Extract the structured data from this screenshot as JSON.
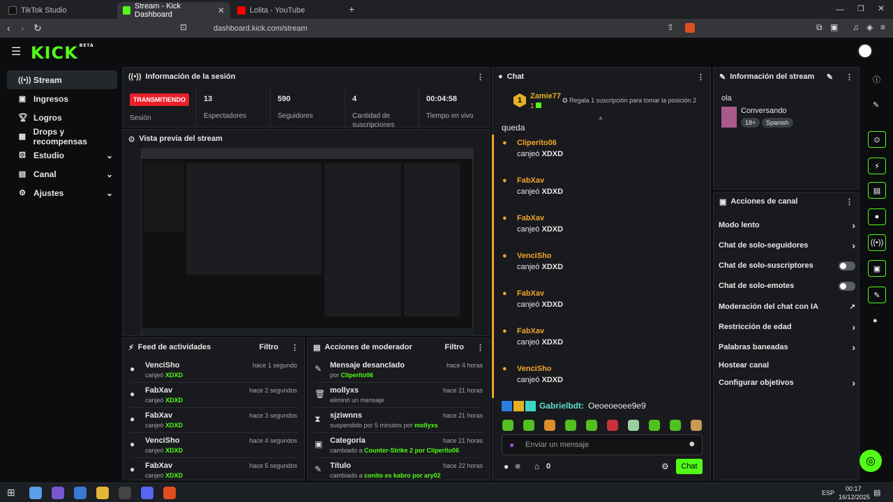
{
  "browser": {
    "tabs": [
      {
        "label": "TikTok Studio"
      },
      {
        "label": "Stream - Kick Dashboard"
      },
      {
        "label": "Lolita - YouTube"
      }
    ],
    "url": "dashboard.kick.com/stream",
    "new_tab": "+"
  },
  "kick": {
    "logo": "KICK",
    "logo_badge": "BETA"
  },
  "sidebar": {
    "items": [
      {
        "label": "Stream",
        "icon": "radio-icon"
      },
      {
        "label": "Ingresos",
        "icon": "wallet-icon"
      },
      {
        "label": "Logros",
        "icon": "trophy-icon"
      },
      {
        "label": "Drops y recompensas",
        "icon": "gift-icon"
      },
      {
        "label": "Estudio",
        "icon": "studio-icon"
      },
      {
        "label": "Canal",
        "icon": "channel-icon"
      },
      {
        "label": "Ajustes",
        "icon": "gear-icon"
      }
    ]
  },
  "session": {
    "title": "Información de la sesión",
    "live_badge": "TRANSMITIENDO",
    "stats": [
      {
        "value": "",
        "label": "Sesión"
      },
      {
        "value": "13",
        "label": "Espectadores"
      },
      {
        "value": "590",
        "label": "Seguidores"
      },
      {
        "value": "4",
        "label": "Cantidad de suscripciones"
      },
      {
        "value": "00:04:58",
        "label": "Tiempo en vivo"
      }
    ]
  },
  "preview": {
    "title": "Vista previa del stream"
  },
  "activity": {
    "title": "Feed de actividades",
    "filter": "Filtro",
    "items": [
      {
        "user": "VenciSho",
        "action": "canjeó",
        "item": "XDXD",
        "time": "hace 1 segundo"
      },
      {
        "user": "FabXav",
        "action": "canjeó",
        "item": "XDXD",
        "time": "hace 2 segundos"
      },
      {
        "user": "FabXav",
        "action": "canjeó",
        "item": "XDXD",
        "time": "hace 3 segundos"
      },
      {
        "user": "VenciSho",
        "action": "canjeó",
        "item": "XDXD",
        "time": "hace 4 segundos"
      },
      {
        "user": "FabXav",
        "action": "canjeó",
        "item": "XDXD",
        "time": "hace 5 segundos"
      }
    ]
  },
  "modactions": {
    "title": "Acciones de moderador",
    "filter": "Filtro",
    "items": [
      {
        "title": "Mensaje desanclado",
        "sub": "por",
        "who": "Cliperito06",
        "time": "hace 4 horas"
      },
      {
        "title": "mollyxs",
        "sub": "eliminó un mensaje",
        "who": "",
        "time": "hace 21 horas"
      },
      {
        "title": "sjziwnns",
        "sub": "suspendido por 5 minutos por",
        "who": "mollyxs",
        "time": "hace 21 horas"
      },
      {
        "title": "Categoría",
        "sub": "cambiado a",
        "who": "Counter-Strike 2 por Cliperito06",
        "time": "hace 21 horas"
      },
      {
        "title": "Título",
        "sub": "cambiado a",
        "who": "conito es kabro por ary02",
        "time": "hace 22 horas"
      }
    ]
  },
  "chat": {
    "title": "Chat",
    "top_gifter": {
      "name": "Zamie77",
      "count": "1",
      "rank": "1"
    },
    "gift_text": "Regala 1 suscripción para tomar la posición 2",
    "queda": "queda",
    "messages": [
      {
        "user": "Cliperito06",
        "action": "canjeó",
        "item": "XDXD"
      },
      {
        "user": "FabXav",
        "action": "canjeó",
        "item": "XDXD"
      },
      {
        "user": "FabXav",
        "action": "canjeó",
        "item": "XDXD"
      },
      {
        "user": "VenciSho",
        "action": "canjeó",
        "item": "XDXD"
      },
      {
        "user": "FabXav",
        "action": "canjeó",
        "item": "XDXD"
      },
      {
        "user": "FabXav",
        "action": "canjeó",
        "item": "XDXD"
      },
      {
        "user": "VenciSho",
        "action": "canjeó",
        "item": "XDXD"
      }
    ],
    "last_msg": {
      "user": "Gabrielbdt:",
      "text": "Oeoeoeoee9e9"
    },
    "input_placeholder": "Enviar un mensaje",
    "count": "0",
    "send": "Chat"
  },
  "streaminfo": {
    "title": "Información del stream",
    "stream_title": "ola",
    "category": "Conversando",
    "tags": [
      "18+",
      "Spanish"
    ]
  },
  "channel": {
    "title": "Acciones de canal",
    "actions": [
      {
        "label": "Modo lento",
        "type": "arrow"
      },
      {
        "label": "Chat de solo-seguidores",
        "type": "arrow"
      },
      {
        "label": "Chat de solo-suscriptores",
        "type": "toggle"
      },
      {
        "label": "Chat de solo-emotes",
        "type": "toggle"
      },
      {
        "label": "Moderación del chat con IA",
        "type": "external"
      },
      {
        "label": "Restricción de edad",
        "type": "arrow"
      },
      {
        "label": "Palabras baneadas",
        "type": "arrow"
      },
      {
        "label": "Hostear canal",
        "type": "none"
      },
      {
        "label": "Configurar objetivos",
        "type": "arrow"
      }
    ]
  },
  "taskbar": {
    "lang": "ESP",
    "time": "00:17",
    "date": "16/12/2025"
  },
  "colors": {
    "accent": "#53fc18",
    "live": "#ea1f2b",
    "orange": "#f1a52b"
  }
}
